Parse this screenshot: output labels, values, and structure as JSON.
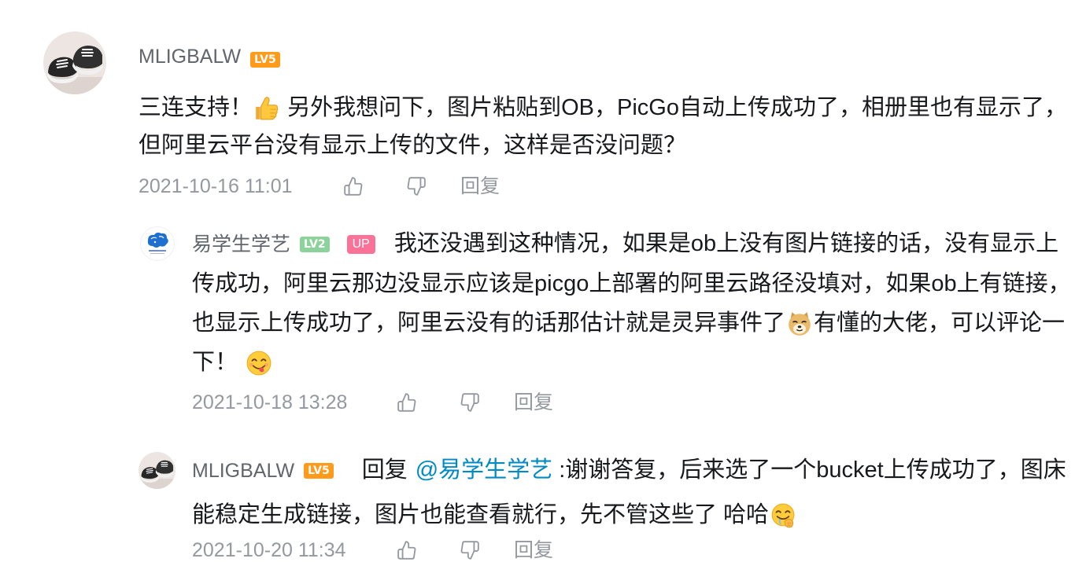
{
  "colors": {
    "username": "#61666d",
    "text": "#18191c",
    "meta": "#9499a0",
    "mention": "#008ac5",
    "level5": "#ff9b1a",
    "level2": "#8bd29b",
    "upBadge": "#fb7299"
  },
  "comment": {
    "avatar": "shoes-photo-avatar",
    "username": "MLIGBALW",
    "level": "LV5",
    "text_before_emoji": "三连支持！",
    "emoji": "thumbs-up-emoji",
    "text_after_emoji": " 另外我想问下，图片粘贴到OB，PicGo自动上传成功了，相册里也有显示了，但阿里云平台没有显示上传的文件，这样是否没问题？",
    "time": "2021-10-16 11:01",
    "like_icon": "thumbs-up-outline-icon",
    "dislike_icon": "thumbs-down-outline-icon",
    "reply_label": "回复"
  },
  "replies": [
    {
      "avatar": "bird-logo-avatar",
      "username": "易学生学艺",
      "level": "LV2",
      "badge": "UP",
      "text_before_emoji": "我还没遇到这种情况，如果是ob上没有图片链接的话，没有显示上传成功，阿里云那边没显示应该是picgo上部署的阿里云路径没填对，如果ob上有链接，也显示上传成功了，阿里云没有的话那估计就是灵异事件了",
      "emoji": "doge-emoji",
      "text_after_emoji": "有懂的大佬，可以评论一下！",
      "end_emoji": "yummy-face-emoji",
      "time": "2021-10-18 13:28",
      "like_icon": "thumbs-up-outline-icon",
      "dislike_icon": "thumbs-down-outline-icon",
      "reply_label": "回复"
    },
    {
      "avatar": "shoes-photo-avatar",
      "username": "MLIGBALW",
      "level": "LV5",
      "reply_prefix": "回复",
      "mention": "@易学生学艺",
      "text_before_emoji": " :谢谢答复，后来选了一个bucket上传成功了，图床能稳定生成链接，图片也能查看就行，先不管这些了 哈哈",
      "emoji": "drooling-face-emoji",
      "time": "2021-10-20 11:34",
      "like_icon": "thumbs-up-outline-icon",
      "dislike_icon": "thumbs-down-outline-icon",
      "reply_label": "回复"
    }
  ]
}
